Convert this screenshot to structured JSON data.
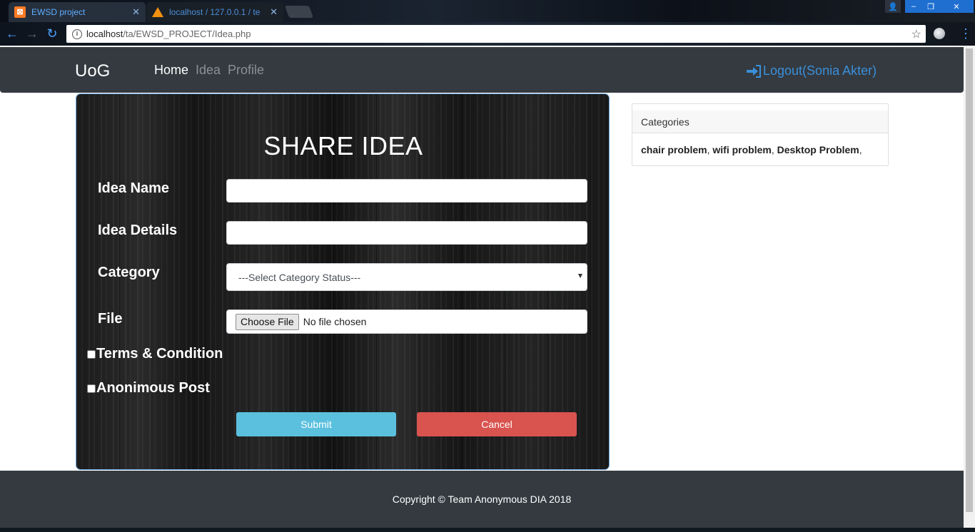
{
  "browser": {
    "tabs": [
      {
        "title": "EWSD project",
        "icon": "xampp-icon",
        "active": true
      },
      {
        "title": "localhost / 127.0.0.1 / te",
        "icon": "phpmyadmin-icon",
        "active": false
      }
    ],
    "url_host": "localhost",
    "url_path": "/ta/EWSD_PROJECT/Idea.php",
    "window_controls": {
      "minimize": "–",
      "maximize": "❐",
      "close": "✕"
    }
  },
  "navbar": {
    "brand": "UoG",
    "links": [
      "Home",
      "Idea",
      "Profile"
    ],
    "logout": "Logout(Sonia Akter)"
  },
  "form": {
    "title": "SHARE IDEA",
    "idea_name_label": "Idea Name",
    "idea_details_label": "Idea Details",
    "category_label": "Category",
    "category_value": "---Select Category Status---",
    "file_label": "File",
    "file_button": "Choose File",
    "file_status": "No file chosen",
    "terms_label": "Terms & Condition",
    "anonymous_label": "Anonimous Post",
    "submit_label": "Submit",
    "cancel_label": "Cancel"
  },
  "categories": {
    "header": "Categories",
    "items": [
      "chair problem",
      "wifi problem",
      "Desktop Problem"
    ]
  },
  "footer": {
    "copyright": "Copyright © Team Anonymous DIA 2018"
  },
  "colors": {
    "navbar_bg": "#343a40",
    "link_active": "#ffffff",
    "link_muted": "#8a9097",
    "logout": "#3b8fd9",
    "submit": "#5bc0de",
    "cancel": "#d9534f"
  }
}
